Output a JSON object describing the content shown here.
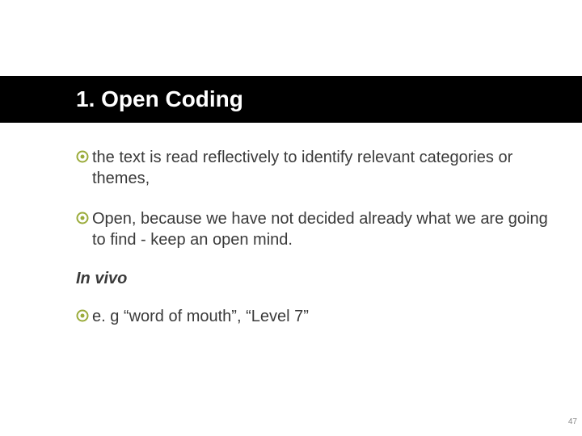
{
  "accent": "#9aab3a",
  "title": "1. Open Coding",
  "bullets": [
    {
      "text": "the text is read reflectively to identify relevant categories or themes,"
    },
    {
      "text": "Open, because we have not decided already what we are going to find - keep an open mind."
    }
  ],
  "subhead": "In vivo",
  "bullets2": [
    {
      "text": "e. g “word of mouth”, “Level 7”"
    }
  ],
  "page_number": "47"
}
